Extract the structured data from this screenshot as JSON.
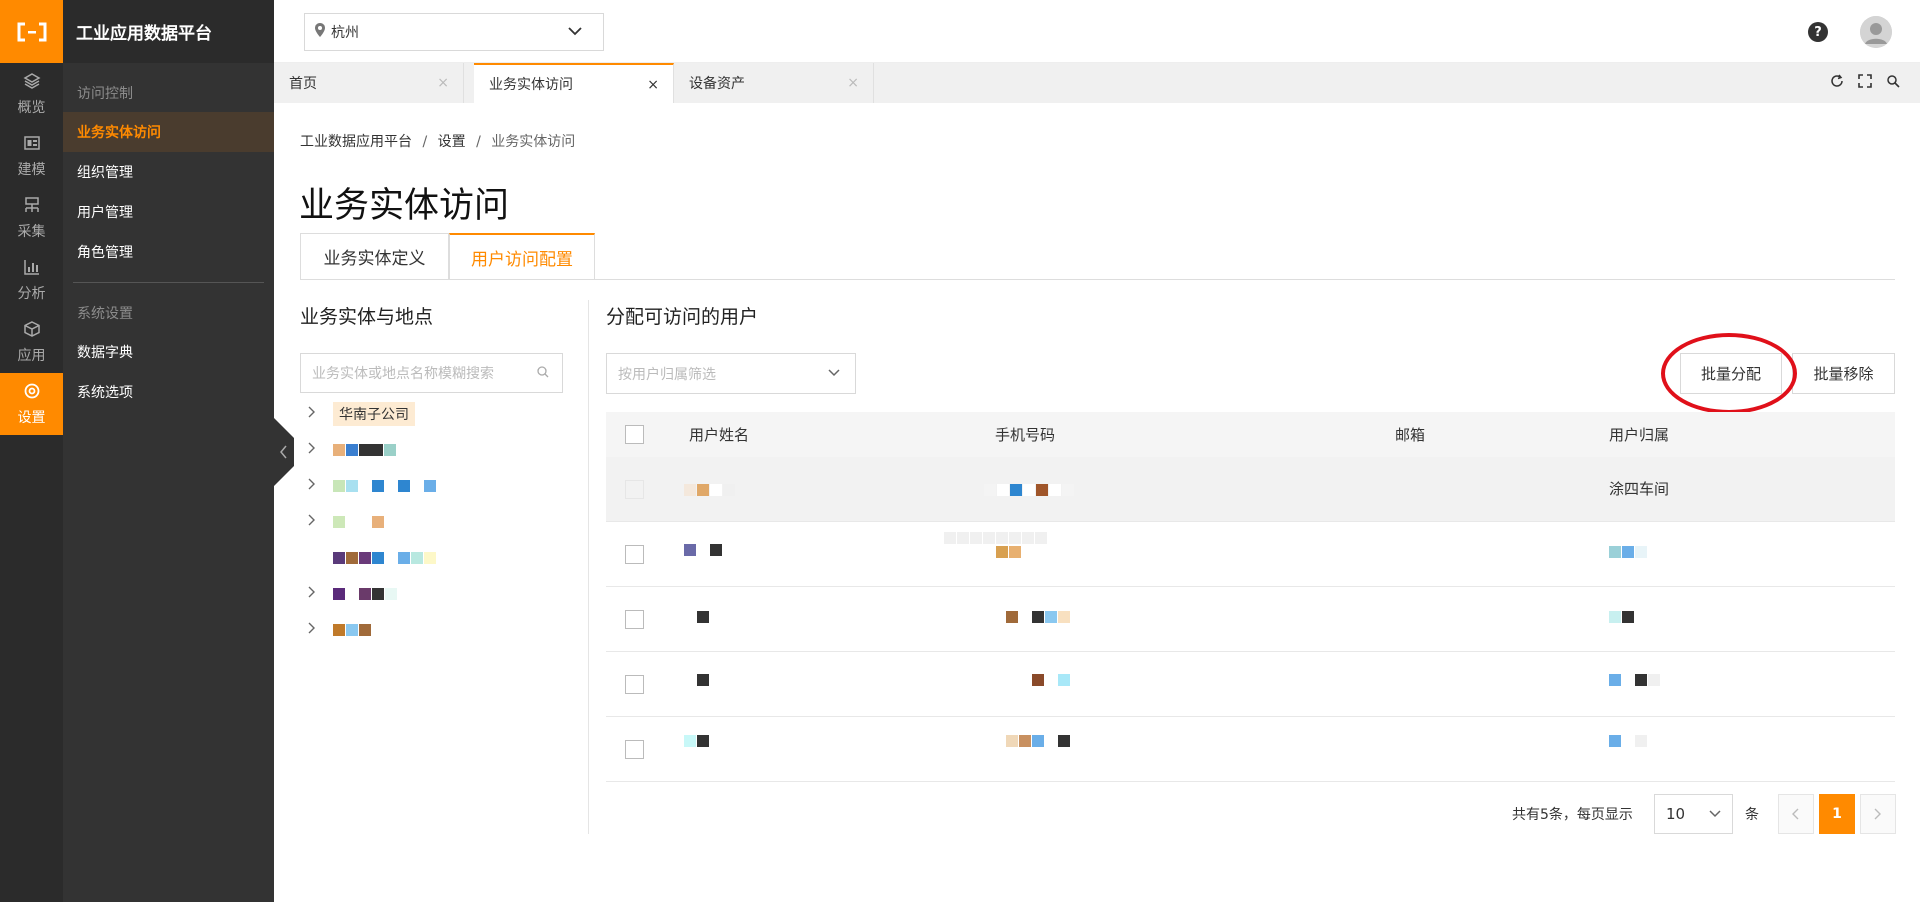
{
  "app": {
    "logo": "(-)",
    "title": "工业应用数据平台"
  },
  "rail": [
    {
      "icon": "layers-icon",
      "label": "概览"
    },
    {
      "icon": "layout-icon",
      "label": "建模"
    },
    {
      "icon": "collect-icon",
      "label": "采集"
    },
    {
      "icon": "chart-icon",
      "label": "分析"
    },
    {
      "icon": "cube-icon",
      "label": "应用"
    },
    {
      "icon": "settings-icon",
      "label": "设置"
    }
  ],
  "sidebar": {
    "group1": "访问控制",
    "items1": [
      "业务实体访问",
      "组织管理",
      "用户管理",
      "角色管理"
    ],
    "group2": "系统设置",
    "items2": [
      "数据字典",
      "系统选项"
    ]
  },
  "topbar": {
    "city": "杭州",
    "help": "?"
  },
  "page_tabs": [
    {
      "label": "首页",
      "close": "×"
    },
    {
      "label": "业务实体访问",
      "close": "×"
    },
    {
      "label": "设备资产",
      "close": "×"
    }
  ],
  "breadcrumb": {
    "root": "工业数据应用平台",
    "mid": "设置",
    "current": "业务实体访问",
    "sep": "/"
  },
  "page_title": "业务实体访问",
  "content_tabs": [
    "业务实体定义",
    "用户访问配置"
  ],
  "left_panel": {
    "title": "业务实体与地点",
    "search_placeholder": "业务实体或地点名称模糊搜索",
    "first_node": "华南子公司"
  },
  "right_panel": {
    "title": "分配可访问的用户",
    "filter_placeholder": "按用户归属筛选",
    "batch_assign": "批量分配",
    "batch_remove": "批量移除"
  },
  "table": {
    "columns": [
      "用户姓名",
      "手机号码",
      "邮箱",
      "用户归属"
    ],
    "row1_owner": "涂四车间"
  },
  "pagination": {
    "total_text": "共有5条，每页显示",
    "page_size": "10",
    "unit": "条",
    "current_page": "1"
  },
  "colors": {
    "accent": "#ff8a00",
    "ring": "#e0101a"
  }
}
